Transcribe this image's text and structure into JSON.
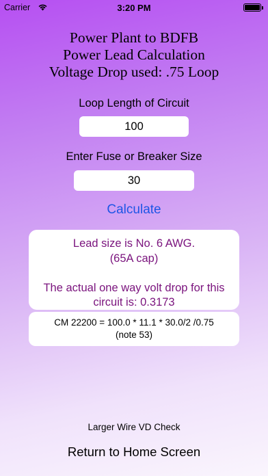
{
  "status_bar": {
    "carrier": "Carrier",
    "time": "3:20 PM",
    "wifi_icon": "wifi-icon",
    "battery_icon": "battery-icon"
  },
  "title": {
    "line1": "Power Plant to BDFB",
    "line2": "Power Lead Calculation",
    "line3": "Voltage Drop used: .75 Loop"
  },
  "loop_length": {
    "label": "Loop Length of Circuit",
    "value": "100"
  },
  "fuse_size": {
    "label": "Enter Fuse or Breaker Size",
    "value": "30"
  },
  "calculate_label": "Calculate",
  "result": {
    "line1": "Lead size is No. 6 AWG.",
    "line2": "(65A cap)",
    "line3": "",
    "line4": "The actual one way volt drop for this",
    "line5": "circuit is: 0.3173"
  },
  "formula": {
    "line1": "CM 22200 = 100.0 * 11.1 * 30.0/2 /0.75",
    "line2": "(note 53)"
  },
  "larger_wire_label": "Larger Wire VD Check",
  "return_home_label": "Return to Home Screen",
  "colors": {
    "accent": "#1d55e6",
    "result_text": "#7a137d",
    "background_top": "#b64ff2",
    "background_bottom": "#faf5fd"
  }
}
